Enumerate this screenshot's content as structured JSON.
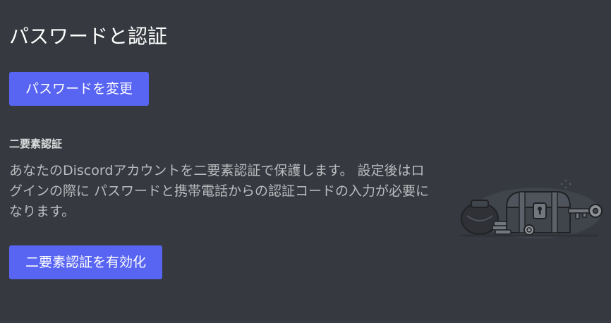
{
  "page": {
    "title": "パスワードと認証"
  },
  "password": {
    "change_button_label": "パスワードを変更"
  },
  "two_factor": {
    "section_label": "二要素認証",
    "description": "あなたのDiscordアカウントを二要素認証で保護します。 設定後はログインの際に パスワードと携帯電話からの認証コードの入力が必要になります。",
    "enable_button_label": "二要素認証を有効化",
    "illustration_icon": "treasure-chest-key-illustration"
  },
  "colors": {
    "background": "#36393f",
    "brand_button": "#5865f2",
    "title_text": "#ffffff",
    "body_text": "#b9bbbe"
  }
}
